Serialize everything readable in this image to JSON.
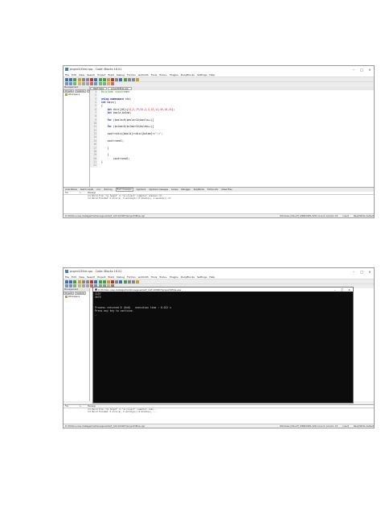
{
  "shot1": {
    "window_title": "project1Ekle.cpp - Code::Blocks 16.01",
    "menu": [
      "File",
      "Edit",
      "View",
      "Search",
      "Project",
      "Build",
      "Debug",
      "Fortran",
      "wxSmith",
      "Tools",
      "Tools+",
      "Plugins",
      "DoxyBlocks",
      "Settings",
      "Help"
    ],
    "management": {
      "header": "Management",
      "tabs": [
        "Projects",
        "Symbols",
        "Files"
      ],
      "workspace": "Workspace"
    },
    "editor_tabs": [
      "Start here",
      "project1Ekle.cpp"
    ],
    "code_lines": [
      {
        "n": "1",
        "html": "<span class='pp'>#include &lt;iostream&gt;</span>"
      },
      {
        "n": "2",
        "html": ""
      },
      {
        "n": "3",
        "html": "<span class='kw'>using namespace</span> std;"
      },
      {
        "n": "4",
        "html": "<span class='kw'>int</span> main()"
      },
      {
        "n": "5",
        "html": "{"
      },
      {
        "n": "6",
        "html": "    <span class='kw'>int</span> dizi[10]={<span class='num'>11</span>,<span class='num'>5</span>,<span class='num'>79</span>,<span class='num'>54</span>,<span class='num'>2</span>,<span class='num'>3</span>,<span class='num'>13</span>,<span class='num'>11</span>,<span class='num'>45</span>,<span class='num'>16</span>,<span class='num'>41</span>};"
      },
      {
        "n": "7",
        "html": "    <span class='kw'>int</span> basla,bulma;"
      },
      {
        "n": "8",
        "html": ""
      },
      {
        "n": "9",
        "html": "    <span class='kw'>for</span> (basla=0;basla&lt;10;basla++){"
      },
      {
        "n": "10",
        "html": ""
      },
      {
        "n": "11",
        "html": "    <span class='kw'>for</span> (bulma=0;bulma&lt;10;bulma++){"
      },
      {
        "n": "12",
        "html": ""
      },
      {
        "n": "13",
        "html": "    cout&lt;&lt;dizi[basla]&lt;&lt;dizi[bulma]&lt;&lt;<span class='str'>\"\\n\"</span>;"
      },
      {
        "n": "14",
        "html": ""
      },
      {
        "n": "15",
        "html": "    cout&lt;&lt;endl;"
      },
      {
        "n": "16",
        "html": ""
      },
      {
        "n": "17",
        "html": "    }"
      },
      {
        "n": "18",
        "html": ""
      },
      {
        "n": "19",
        "html": "    }"
      },
      {
        "n": "20",
        "html": "        cout&lt;&lt;endl;"
      },
      {
        "n": "21",
        "html": "}"
      },
      {
        "n": "22",
        "html": ""
      }
    ],
    "log_tabs": [
      "Code::Blocks",
      "Search results",
      "Cccc",
      "Build log",
      "Build messages",
      "CppCheck",
      "CppCheck messages",
      "Cscope",
      "Debugger",
      "DoxyBlocks",
      "Fortran info",
      "Closed files"
    ],
    "log_headers": [
      "File",
      "L...",
      "Message"
    ],
    "log_rows": [
      {
        "file": "",
        "line": "",
        "msg": "=== Build file: \"no target\" in \"no project\" (compiler: unknown) ==="
      },
      {
        "file": "",
        "line": "",
        "msg": "=== Build finished: 0 error(s), 0 warning(s) (0 minute(s), 1 second(s)) ==="
      }
    ],
    "status": {
      "path": "D:\\Hidden-new-Instalgelmis\\Sinavgenel\\ALT_CAT-103007\\project1Ekle.cpp",
      "enc": "Windows (CR+LF) WINDOWS-1252 Line 9, Column 34",
      "mode": "Insert",
      "rw": "Read/Write default"
    }
  },
  "shot2": {
    "window_title": "project1Ekle.cpp - Code::Blocks 16.01",
    "menu": [
      "File",
      "Edit",
      "View",
      "Search",
      "Project",
      "Build",
      "Debug",
      "Fortran",
      "wxSmith",
      "Tools",
      "Tools+",
      "Plugins",
      "DoxyBlocks",
      "Settings",
      "Help"
    ],
    "management": {
      "header": "Management",
      "tabs": [
        "Projects",
        "Symbols"
      ],
      "workspace": "Workspace"
    },
    "console_title": "D:\\Hidden-new-Instalgelmis\\Sinavgenel\\ALT_CAT-103007\\project1Ekle.exe",
    "console_lines": [
      "1157",
      "5679",
      "",
      "",
      "Process returned 0 (0x0)   execution time : 0.012 s",
      "Press any key to continue.",
      "_"
    ],
    "log_headers": [
      "File",
      "L...",
      "Message"
    ],
    "log_rows": [
      {
        "file": "",
        "line": "",
        "msg": "=== Build file: \"no target\" in \"no project\" (compiler: unkn..."
      },
      {
        "file": "",
        "line": "",
        "msg": "=== Build finished: 0 error(s), 0 warning(s) (0 minute(s), ..."
      }
    ],
    "status": {
      "path": "D:\\Hidden-new-Instalgelmis\\Sinavgenel\\ALT_CAT-103007\\project1Ekle.cpp",
      "enc": "Windows (CR+LF) WINDOWS-1252 Line 9, Column 34",
      "mode": "Insert",
      "rw": "Read/Write default"
    }
  }
}
